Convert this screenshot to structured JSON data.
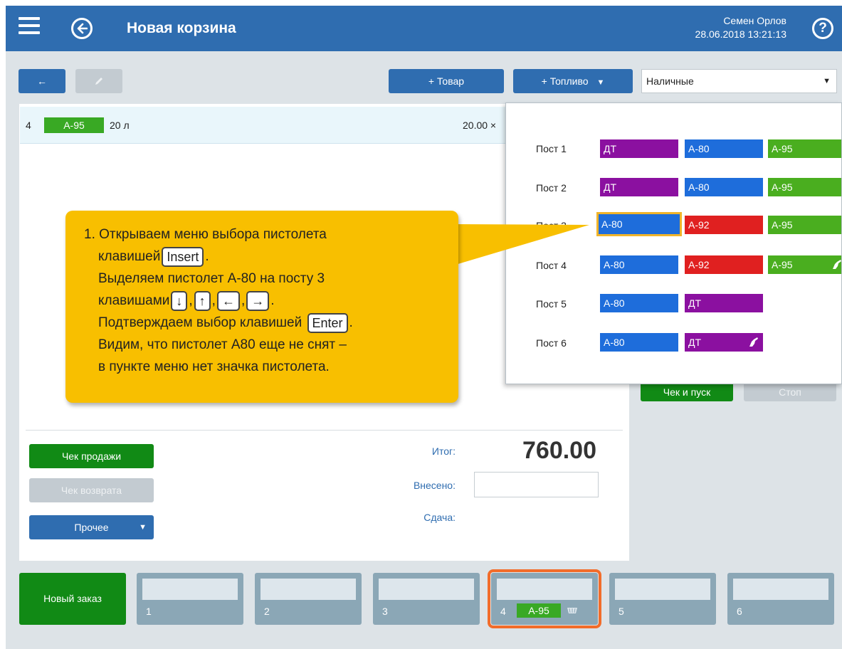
{
  "header": {
    "title": "Новая корзина",
    "user_name": "Семен Орлов",
    "datetime": "28.06.2018 13:21:13",
    "help_glyph": "?"
  },
  "toolbar": {
    "back_label": "←",
    "add_product_label": "+ Товар",
    "add_fuel_label": "+ Топливо",
    "add_fuel_caret": "▼",
    "payment_method": "Наличные",
    "payment_caret": "▼"
  },
  "cart": {
    "rows": [
      {
        "num": "4",
        "fuel": "А-95",
        "qty": "20 л",
        "price": "20.00 ×"
      }
    ]
  },
  "fuel_menu": {
    "posts": [
      {
        "label": "Пост 1",
        "nozzles": [
          {
            "name": "ДТ",
            "color": "#8b10a0",
            "pistol": false
          },
          {
            "name": "А-80",
            "color": "#1e6ddb",
            "pistol": false
          },
          {
            "name": "А-95",
            "color": "#4aae1f",
            "pistol": false
          }
        ]
      },
      {
        "label": "Пост 2",
        "nozzles": [
          {
            "name": "ДТ",
            "color": "#8b10a0",
            "pistol": false
          },
          {
            "name": "А-80",
            "color": "#1e6ddb",
            "pistol": false
          },
          {
            "name": "А-95",
            "color": "#4aae1f",
            "pistol": false
          }
        ]
      },
      {
        "label": "Пост 3",
        "nozzles": [
          {
            "name": "А-80",
            "color": "#1e6ddb",
            "pistol": false,
            "selected": true
          },
          {
            "name": "А-92",
            "color": "#e02020",
            "pistol": false
          },
          {
            "name": "А-95",
            "color": "#4aae1f",
            "pistol": false
          }
        ]
      },
      {
        "label": "Пост 4",
        "nozzles": [
          {
            "name": "А-80",
            "color": "#1e6ddb",
            "pistol": false
          },
          {
            "name": "А-92",
            "color": "#e02020",
            "pistol": false
          },
          {
            "name": "А-95",
            "color": "#4aae1f",
            "pistol": true
          }
        ]
      },
      {
        "label": "Пост 5",
        "nozzles": [
          {
            "name": "А-80",
            "color": "#1e6ddb",
            "pistol": false
          },
          {
            "name": "ДТ",
            "color": "#8b10a0",
            "pistol": false
          }
        ]
      },
      {
        "label": "Пост 6",
        "nozzles": [
          {
            "name": "А-80",
            "color": "#1e6ddb",
            "pistol": false
          },
          {
            "name": "ДТ",
            "color": "#8b10a0",
            "pistol": true
          }
        ]
      }
    ]
  },
  "dispense": {
    "check_start_label": "Чек и пуск",
    "stop_label": "Стоп"
  },
  "callout": {
    "line1": "1. Открываем меню выбора пистолета",
    "line2_text": "клавишей",
    "key_insert": "Insert",
    "line2_end": ".",
    "line3": "Выделяем пистолет А-80 на посту 3",
    "line4_text": "клавишами",
    "key_down": "↓",
    "key_up": "↑",
    "key_left": "←",
    "key_right": "→",
    "comma": ",",
    "line4_end": ".",
    "line5_text": "Подтверждаем выбор клавишей",
    "key_enter": "Enter",
    "line5_end": ".",
    "line6": "Видим, что пистолет А80 еще не снят –",
    "line7": "в пункте меню нет значка пистолета."
  },
  "totals": {
    "total_label": "Итог:",
    "total_value": "760.00",
    "paid_label": "Внесено:",
    "paid_value": "",
    "change_label": "Сдача:"
  },
  "actions": {
    "sale_receipt": "Чек продажи",
    "return_receipt": "Чек возврата",
    "other": "Прочее",
    "other_caret": "▼"
  },
  "orders": {
    "new_order_label": "Новый заказ",
    "tabs": [
      {
        "num": "1"
      },
      {
        "num": "2"
      },
      {
        "num": "3"
      },
      {
        "num": "4",
        "fuel": "А-95",
        "active": true
      },
      {
        "num": "5"
      },
      {
        "num": "6"
      }
    ]
  }
}
